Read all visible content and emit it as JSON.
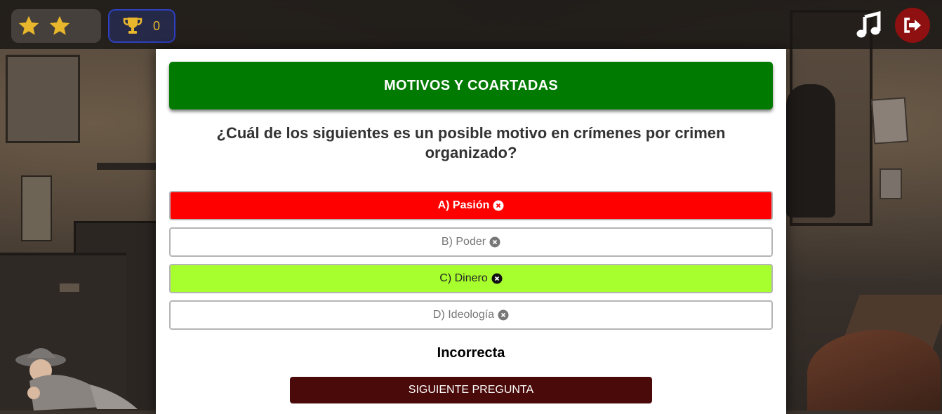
{
  "header": {
    "stars_count": 2,
    "trophy_count": "0",
    "music_icon": "music-note-icon",
    "exit_icon": "sign-out-icon"
  },
  "quiz": {
    "category": "MOTIVOS Y COARTADAS",
    "question": "¿Cuál de los siguientes es un posible motivo en crímenes por crimen organizado?",
    "options": [
      {
        "label": "A) Pasión",
        "state": "selected-wrong"
      },
      {
        "label": "B) Poder",
        "state": "disabled"
      },
      {
        "label": "C) Dinero",
        "state": "correct"
      },
      {
        "label": "D) Ideología",
        "state": "disabled"
      }
    ],
    "result": "Incorrecta",
    "next_label": "SIGUIENTE PREGUNTA"
  },
  "colors": {
    "category_bg": "#007a00",
    "wrong_bg": "#ff0000",
    "correct_bg": "#a8ff2e",
    "next_bg": "#4a0a0a",
    "star": "#e8b72c",
    "exit_bg": "#8f1010"
  }
}
